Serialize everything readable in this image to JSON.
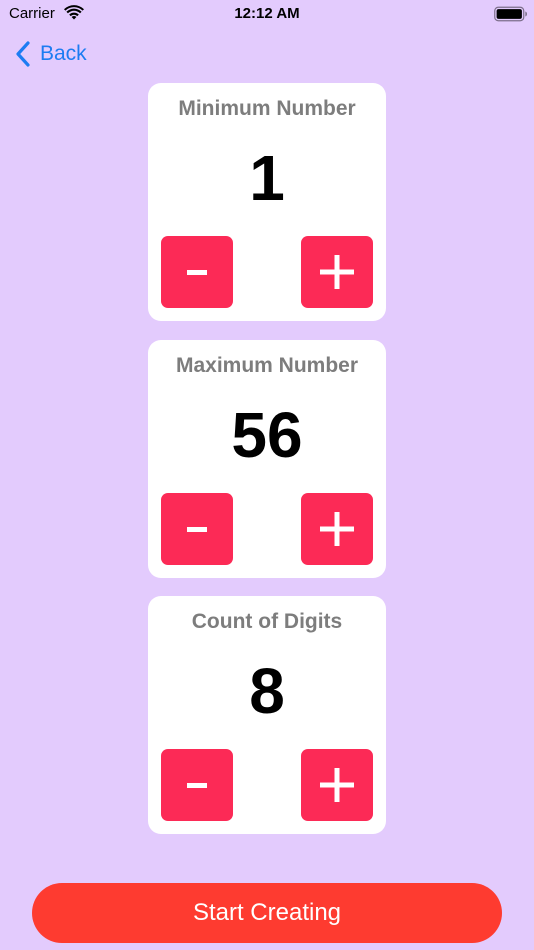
{
  "status_bar": {
    "carrier": "Carrier",
    "time": "12:12 AM",
    "wifi_icon": "wifi-icon",
    "battery_icon": "battery-full-icon"
  },
  "nav": {
    "back_label": "Back",
    "back_icon": "chevron-left-icon"
  },
  "cards": [
    {
      "title": "Minimum Number",
      "value": "1"
    },
    {
      "title": "Maximum Number",
      "value": "56"
    },
    {
      "title": "Count of Digits",
      "value": "8"
    }
  ],
  "start_button": {
    "label": "Start Creating"
  },
  "colors": {
    "background": "#e3cbfd",
    "card": "#ffffff",
    "stepper": "#fc2a56",
    "start_button": "#fe3b30",
    "accent": "#1d7cf2",
    "title_text": "#7d7d7d"
  }
}
